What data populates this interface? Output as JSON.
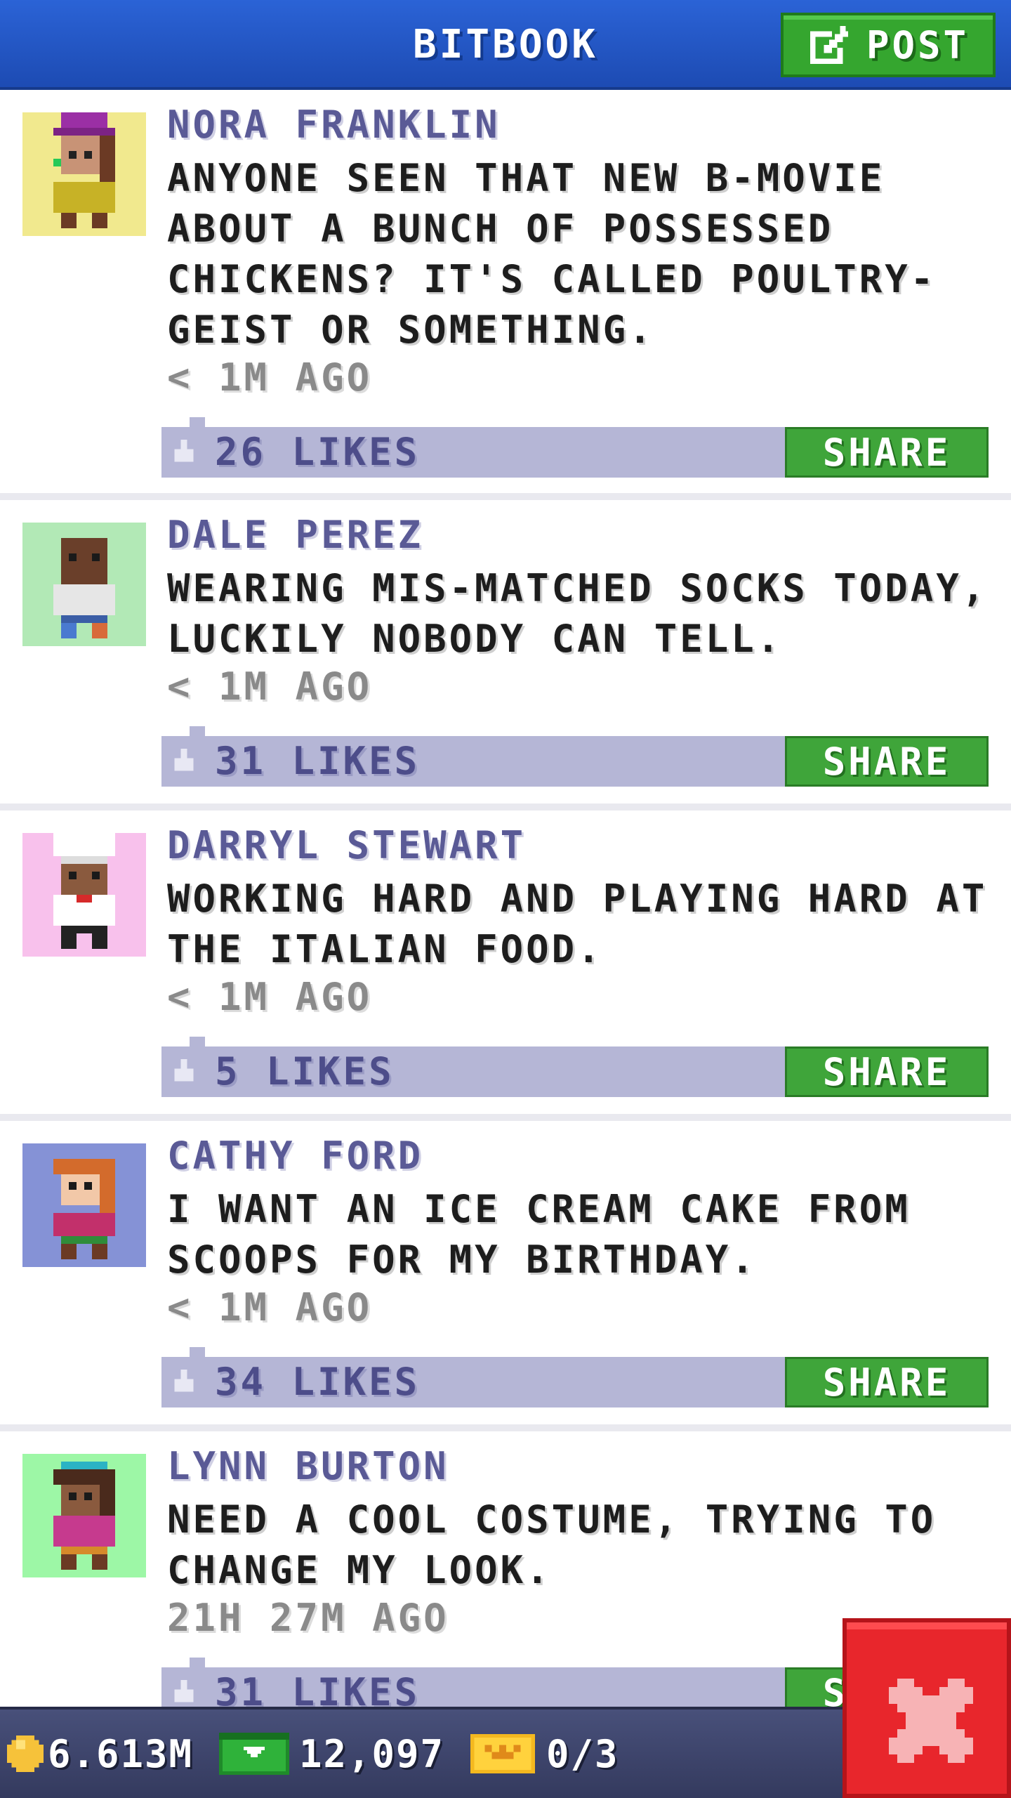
{
  "header": {
    "title": "BITBOOK",
    "post_label": "POST"
  },
  "posts": [
    {
      "author": "NORA FRANKLIN",
      "text": "ANYONE SEEN THAT NEW B-MOVIE ABOUT A BUNCH OF POSSESSED CHICKENS? IT'S CALLED POULTRY-GEIST OR SOMETHING.",
      "time": "< 1M AGO",
      "likes": "26 LIKES",
      "share_label": "SHARE",
      "avatar_bg": "#f1e98e"
    },
    {
      "author": "DALE PEREZ",
      "text": "WEARING MIS-MATCHED SOCKS TODAY, LUCKILY NOBODY CAN TELL.",
      "time": "< 1M AGO",
      "likes": "31 LIKES",
      "share_label": "SHARE",
      "avatar_bg": "#b2e9b6"
    },
    {
      "author": "DARRYL STEWART",
      "text": "WORKING HARD AND PLAYING HARD AT THE ITALIAN FOOD.",
      "time": "< 1M AGO",
      "likes": "5 LIKES",
      "share_label": "SHARE",
      "avatar_bg": "#f8c1ec"
    },
    {
      "author": "CATHY FORD",
      "text": "I WANT AN ICE CREAM CAKE FROM SCOOPS FOR MY BIRTHDAY.",
      "time": "< 1M AGO",
      "likes": "34 LIKES",
      "share_label": "SHARE",
      "avatar_bg": "#8592d6"
    },
    {
      "author": "LYNN BURTON",
      "text": "NEED A COOL COSTUME, TRYING TO CHANGE MY LOOK.",
      "time": "21H 27M AGO",
      "likes": "31 LIKES",
      "share_label": "SHARE",
      "avatar_bg": "#9df7a6"
    }
  ],
  "footer": {
    "coins": "6.613M",
    "bux": "12,097",
    "tickets": "0/3"
  },
  "colors": {
    "header_blue": "#2458c8",
    "post_green": "#35a62f",
    "likes_bar": "#b5b6d6",
    "close_red": "#e8262c"
  },
  "icons": [
    "edit-icon",
    "thumb-up-icon",
    "coin-icon",
    "cash-icon",
    "ticket-icon",
    "close-icon"
  ]
}
